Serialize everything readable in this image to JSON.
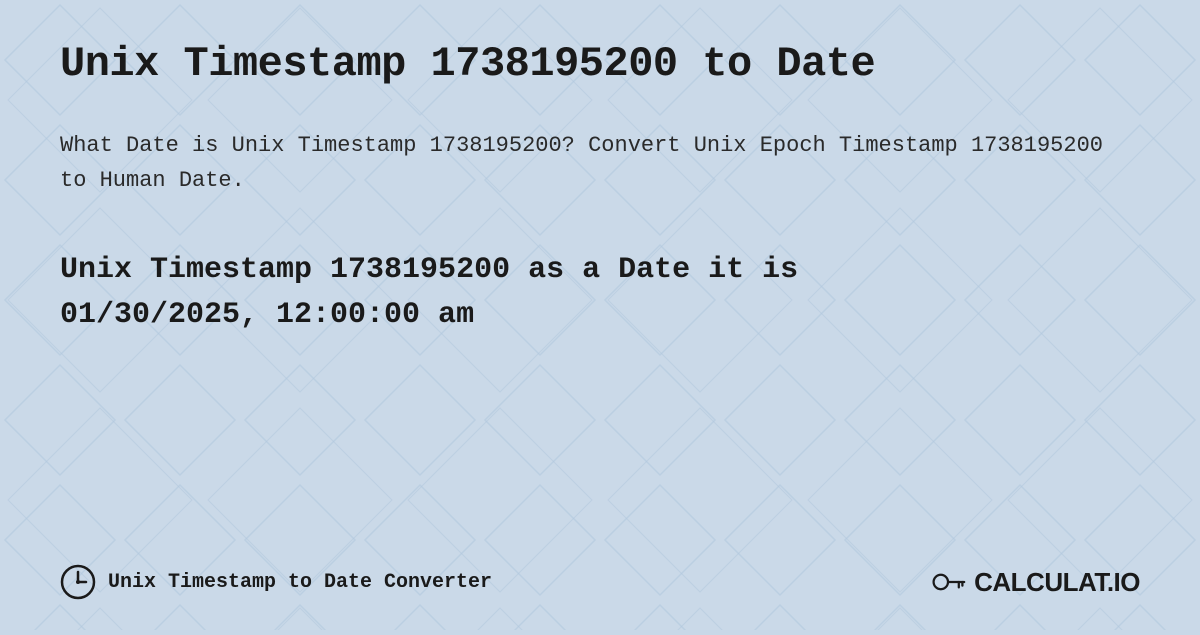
{
  "page": {
    "title": "Unix Timestamp 1738195200 to Date",
    "description": "What Date is Unix Timestamp 1738195200? Convert Unix Epoch Timestamp 1738195200 to Human Date.",
    "result_text_line1": "Unix Timestamp 1738195200 as a Date it is",
    "result_text_line2": "01/30/2025, 12:00:00 am",
    "footer_label": "Unix Timestamp to Date Converter",
    "logo_text": "CALCULAT.IO"
  },
  "icons": {
    "clock": "clock-icon",
    "logo": "calculat-logo-icon"
  },
  "colors": {
    "background": "#c8daea",
    "text_dark": "#1a1a1a",
    "text_medium": "#2a2a2a"
  }
}
